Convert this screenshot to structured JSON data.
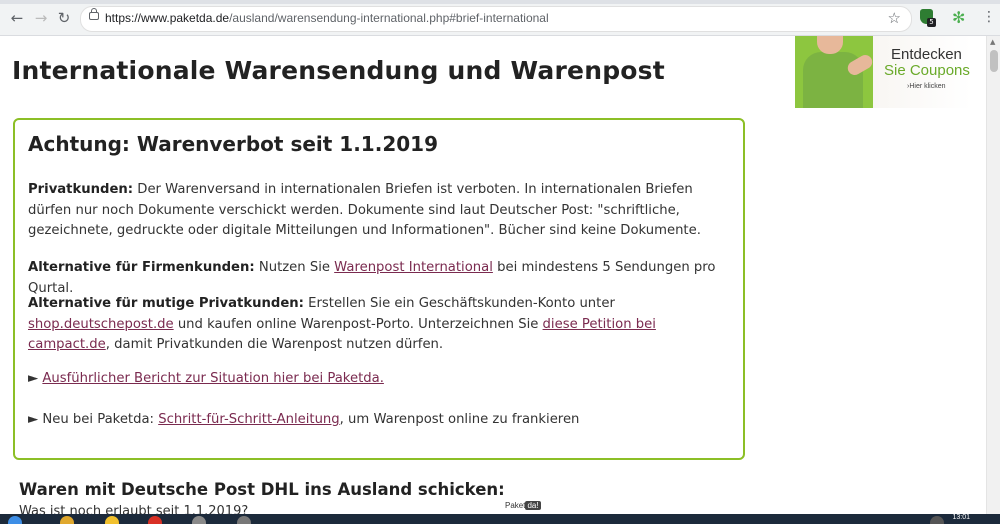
{
  "browser": {
    "url_domain": "https://www.paketda.de",
    "url_path": "/ausland/warensendung-international.php#brief-international",
    "extension_badge": "5"
  },
  "ad": {
    "line1": "Entdecken",
    "line2": "Sie Coupons",
    "line3": "›Hier klicken"
  },
  "page": {
    "title": "Internationale Warensendung und Warenpost",
    "notice": {
      "heading": "Achtung: Warenverbot seit 1.1.2019",
      "p1_bold": "Privatkunden:",
      "p1_text": " Der Warenversand in internationalen Briefen ist verboten. In internationalen Briefen dürfen nur noch Dokumente verschickt werden. Dokumente sind laut Deutscher Post: \"schriftliche, gezeichnete, gedruckte oder digitale Mitteilungen und Informationen\". Bücher sind keine Dokumente.",
      "p2_bold": "Alternative für Firmenkunden:",
      "p2_pre": " Nutzen Sie ",
      "p2_link": "Warenpost International",
      "p2_post": " bei mindestens 5 Sendungen pro Qurtal.",
      "p3_bold": "Alternative für mutige Privatkunden:",
      "p3_pre": " Erstellen Sie ein Geschäftskunden-Konto unter ",
      "p3_link1": "shop.deutschepost.de",
      "p3_mid": " und kaufen online Warenpost-Porto. Unterzeichnen Sie ",
      "p3_link2": "diese Petition bei campact.de",
      "p3_post": ", damit Privatkunden die Warenpost nutzen dürfen.",
      "p4_arrow": "►",
      "p4_link": "Ausführlicher Bericht zur Situation hier bei Paketda.",
      "p5_arrow": "►",
      "p5_pre": " Neu bei Paketda: ",
      "p5_link": "Schritt-für-Schritt-Anleitung",
      "p5_post": ", um Warenpost online zu frankieren"
    },
    "section_heading": "Waren mit Deutsche Post DHL ins Ausland schicken:",
    "cut_text": "Was ist noch erlaubt seit 1.1.2019?",
    "logo_text": "Paket",
    "logo_box": "da!"
  },
  "taskbar": {
    "clock": "13:01"
  }
}
